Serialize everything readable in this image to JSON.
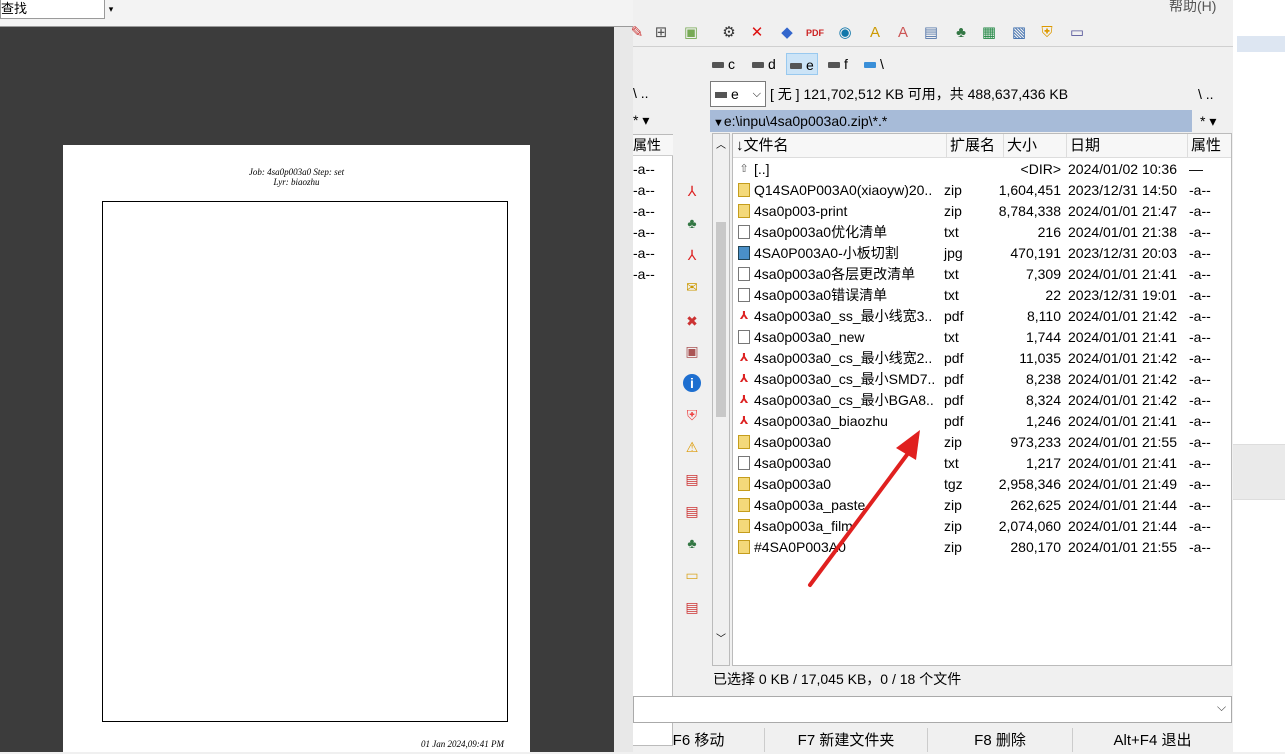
{
  "viewer": {
    "find_text": "查找",
    "page_header_line1": "Job: 4sa0p003a0  Step: set",
    "page_header_line2": "Lyr: biaozhu",
    "page_footer": "01 Jan 2024,09:41 PM"
  },
  "menubar": {
    "help": "帮助(H)"
  },
  "drives": [
    {
      "label": "c"
    },
    {
      "label": "d"
    },
    {
      "label": "e"
    },
    {
      "label": "f"
    },
    {
      "label": "\\"
    }
  ],
  "left_panel": {
    "path": "\\  ..",
    "filter": "*  ▾",
    "header_attr": "属性",
    "rows": [
      "-a--",
      "-a--",
      "-a--",
      "-a--",
      "-a--",
      "-a--"
    ]
  },
  "right_panel": {
    "drive_select": "e",
    "drive_info": "[ 无 ]  121,702,512 KB 可用，共 488,637,436 KB",
    "nav": "\\  ..",
    "path": "e:\\inpu\\4sa0p003a0.zip\\*.*",
    "filter": "*  ▾",
    "columns": {
      "name": "文件名",
      "ext": "扩展名",
      "size": "大小",
      "date": "日期",
      "attr": "属性"
    },
    "files": [
      {
        "icon": "up",
        "name": "[..]",
        "ext": "",
        "size": "<DIR>",
        "date": "2024/01/02 10:36",
        "attr": "—"
      },
      {
        "icon": "zip",
        "name": "Q14SA0P003A0(xiaoyw)20..",
        "ext": "zip",
        "size": "1,604,451",
        "date": "2023/12/31 14:50",
        "attr": "-a--"
      },
      {
        "icon": "zip",
        "name": "4sa0p003-print",
        "ext": "zip",
        "size": "8,784,338",
        "date": "2024/01/01 21:47",
        "attr": "-a--"
      },
      {
        "icon": "txt",
        "name": "4sa0p003a0优化清单",
        "ext": "txt",
        "size": "216",
        "date": "2024/01/01 21:38",
        "attr": "-a--"
      },
      {
        "icon": "jpg",
        "name": "4SA0P003A0-小板切割",
        "ext": "jpg",
        "size": "470,191",
        "date": "2023/12/31 20:03",
        "attr": "-a--"
      },
      {
        "icon": "txt",
        "name": "4sa0p003a0各层更改清单",
        "ext": "txt",
        "size": "7,309",
        "date": "2024/01/01 21:41",
        "attr": "-a--"
      },
      {
        "icon": "txt",
        "name": "4sa0p003a0错误清单",
        "ext": "txt",
        "size": "22",
        "date": "2023/12/31 19:01",
        "attr": "-a--"
      },
      {
        "icon": "pdf",
        "name": "4sa0p003a0_ss_最小线宽3..",
        "ext": "pdf",
        "size": "8,110",
        "date": "2024/01/01 21:42",
        "attr": "-a--"
      },
      {
        "icon": "txt",
        "name": "4sa0p003a0_new",
        "ext": "txt",
        "size": "1,744",
        "date": "2024/01/01 21:41",
        "attr": "-a--"
      },
      {
        "icon": "pdf",
        "name": "4sa0p003a0_cs_最小线宽2..",
        "ext": "pdf",
        "size": "11,035",
        "date": "2024/01/01 21:42",
        "attr": "-a--"
      },
      {
        "icon": "pdf",
        "name": "4sa0p003a0_cs_最小SMD7..",
        "ext": "pdf",
        "size": "8,238",
        "date": "2024/01/01 21:42",
        "attr": "-a--"
      },
      {
        "icon": "pdf",
        "name": "4sa0p003a0_cs_最小BGA8..",
        "ext": "pdf",
        "size": "8,324",
        "date": "2024/01/01 21:42",
        "attr": "-a--"
      },
      {
        "icon": "pdf",
        "name": "4sa0p003a0_biaozhu",
        "ext": "pdf",
        "size": "1,246",
        "date": "2024/01/01 21:41",
        "attr": "-a--"
      },
      {
        "icon": "zip",
        "name": "4sa0p003a0",
        "ext": "zip",
        "size": "973,233",
        "date": "2024/01/01 21:55",
        "attr": "-a--"
      },
      {
        "icon": "txt",
        "name": "4sa0p003a0",
        "ext": "txt",
        "size": "1,217",
        "date": "2024/01/01 21:41",
        "attr": "-a--"
      },
      {
        "icon": "zip",
        "name": "4sa0p003a0",
        "ext": "tgz",
        "size": "2,958,346",
        "date": "2024/01/01 21:49",
        "attr": "-a--"
      },
      {
        "icon": "zip",
        "name": "4sa0p003a_paste",
        "ext": "zip",
        "size": "262,625",
        "date": "2024/01/01 21:44",
        "attr": "-a--"
      },
      {
        "icon": "zip",
        "name": "4sa0p003a_film",
        "ext": "zip",
        "size": "2,074,060",
        "date": "2024/01/01 21:44",
        "attr": "-a--"
      },
      {
        "icon": "zip",
        "name": "#4SA0P003A0",
        "ext": "zip",
        "size": "280,170",
        "date": "2024/01/01 21:55",
        "attr": "-a--"
      }
    ],
    "status": "已选择 0 KB / 17,045 KB，0 / 18 个文件"
  },
  "fkeys": [
    "F6 移动",
    "F7 新建文件夹",
    "F8 删除",
    "Alt+F4 退出"
  ],
  "colors": {
    "path_bar": "#a7bbd8",
    "viewer_bg": "#3c3c3c",
    "arrow": "#e0201f"
  }
}
